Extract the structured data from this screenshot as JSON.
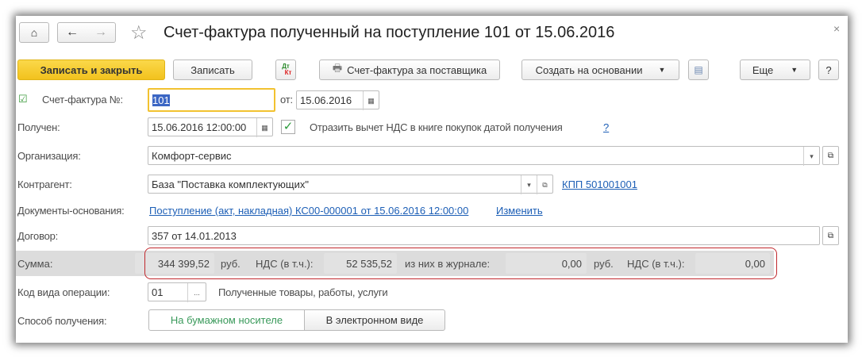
{
  "window": {
    "title": "Счет-фактура полученный на поступление 101 от 15.06.2016",
    "close": "×"
  },
  "nav": {
    "home_icon": "home-icon",
    "back": "←",
    "forward": "→",
    "star": "☆"
  },
  "toolbar": {
    "save_close": "Записать и закрыть",
    "save": "Записать",
    "dtkt_top": "Дт",
    "dtkt_bottom": "Кт",
    "supplier_invoice": "Счет-фактура за поставщика",
    "create_based": "Создать на основании",
    "more": "Еще",
    "help": "?"
  },
  "form": {
    "invoice_label": "Счет-фактура №:",
    "invoice_number": "101",
    "from_label": "от:",
    "invoice_date": "15.06.2016",
    "received_label": "Получен:",
    "received_date": "15.06.2016 12:00:00",
    "vat_checkbox_label": "Отразить вычет НДС в книге покупок датой получения",
    "vat_help": "?",
    "org_label": "Организация:",
    "org_value": "Комфорт-сервис",
    "counterparty_label": "Контрагент:",
    "counterparty_value": "База \"Поставка комплектующих\"",
    "kpp_link": "КПП 501001001",
    "docs_label": "Документы-основания:",
    "docs_link": "Поступление (акт, накладная) КС00-000001 от 15.06.2016 12:00:00",
    "docs_change": "Изменить",
    "contract_label": "Договор:",
    "contract_value": "357 от 14.01.2013",
    "sum_label": "Сумма:",
    "sum_value": "344 399,52",
    "rub1": "руб.",
    "vat_label1": "НДС (в т.ч.):",
    "vat_value": "52 535,52",
    "journal_label": "из них в журнале:",
    "journal_value": "0,00",
    "rub2": "руб.",
    "vat_label2": "НДС (в т.ч.):",
    "journal_vat_value": "0,00",
    "op_code_label": "Код вида операции:",
    "op_code_value": "01",
    "op_code_btn": "...",
    "op_code_desc": "Полученные товары, работы, услуги",
    "method_label": "Способ получения:",
    "method_paper": "На бумажном носителе",
    "method_electronic": "В электронном виде"
  },
  "colors": {
    "accent_yellow": "#f5c924",
    "link": "#1d5fb6",
    "highlight_border": "#c0282d",
    "selected_green": "#3a9a5b"
  }
}
